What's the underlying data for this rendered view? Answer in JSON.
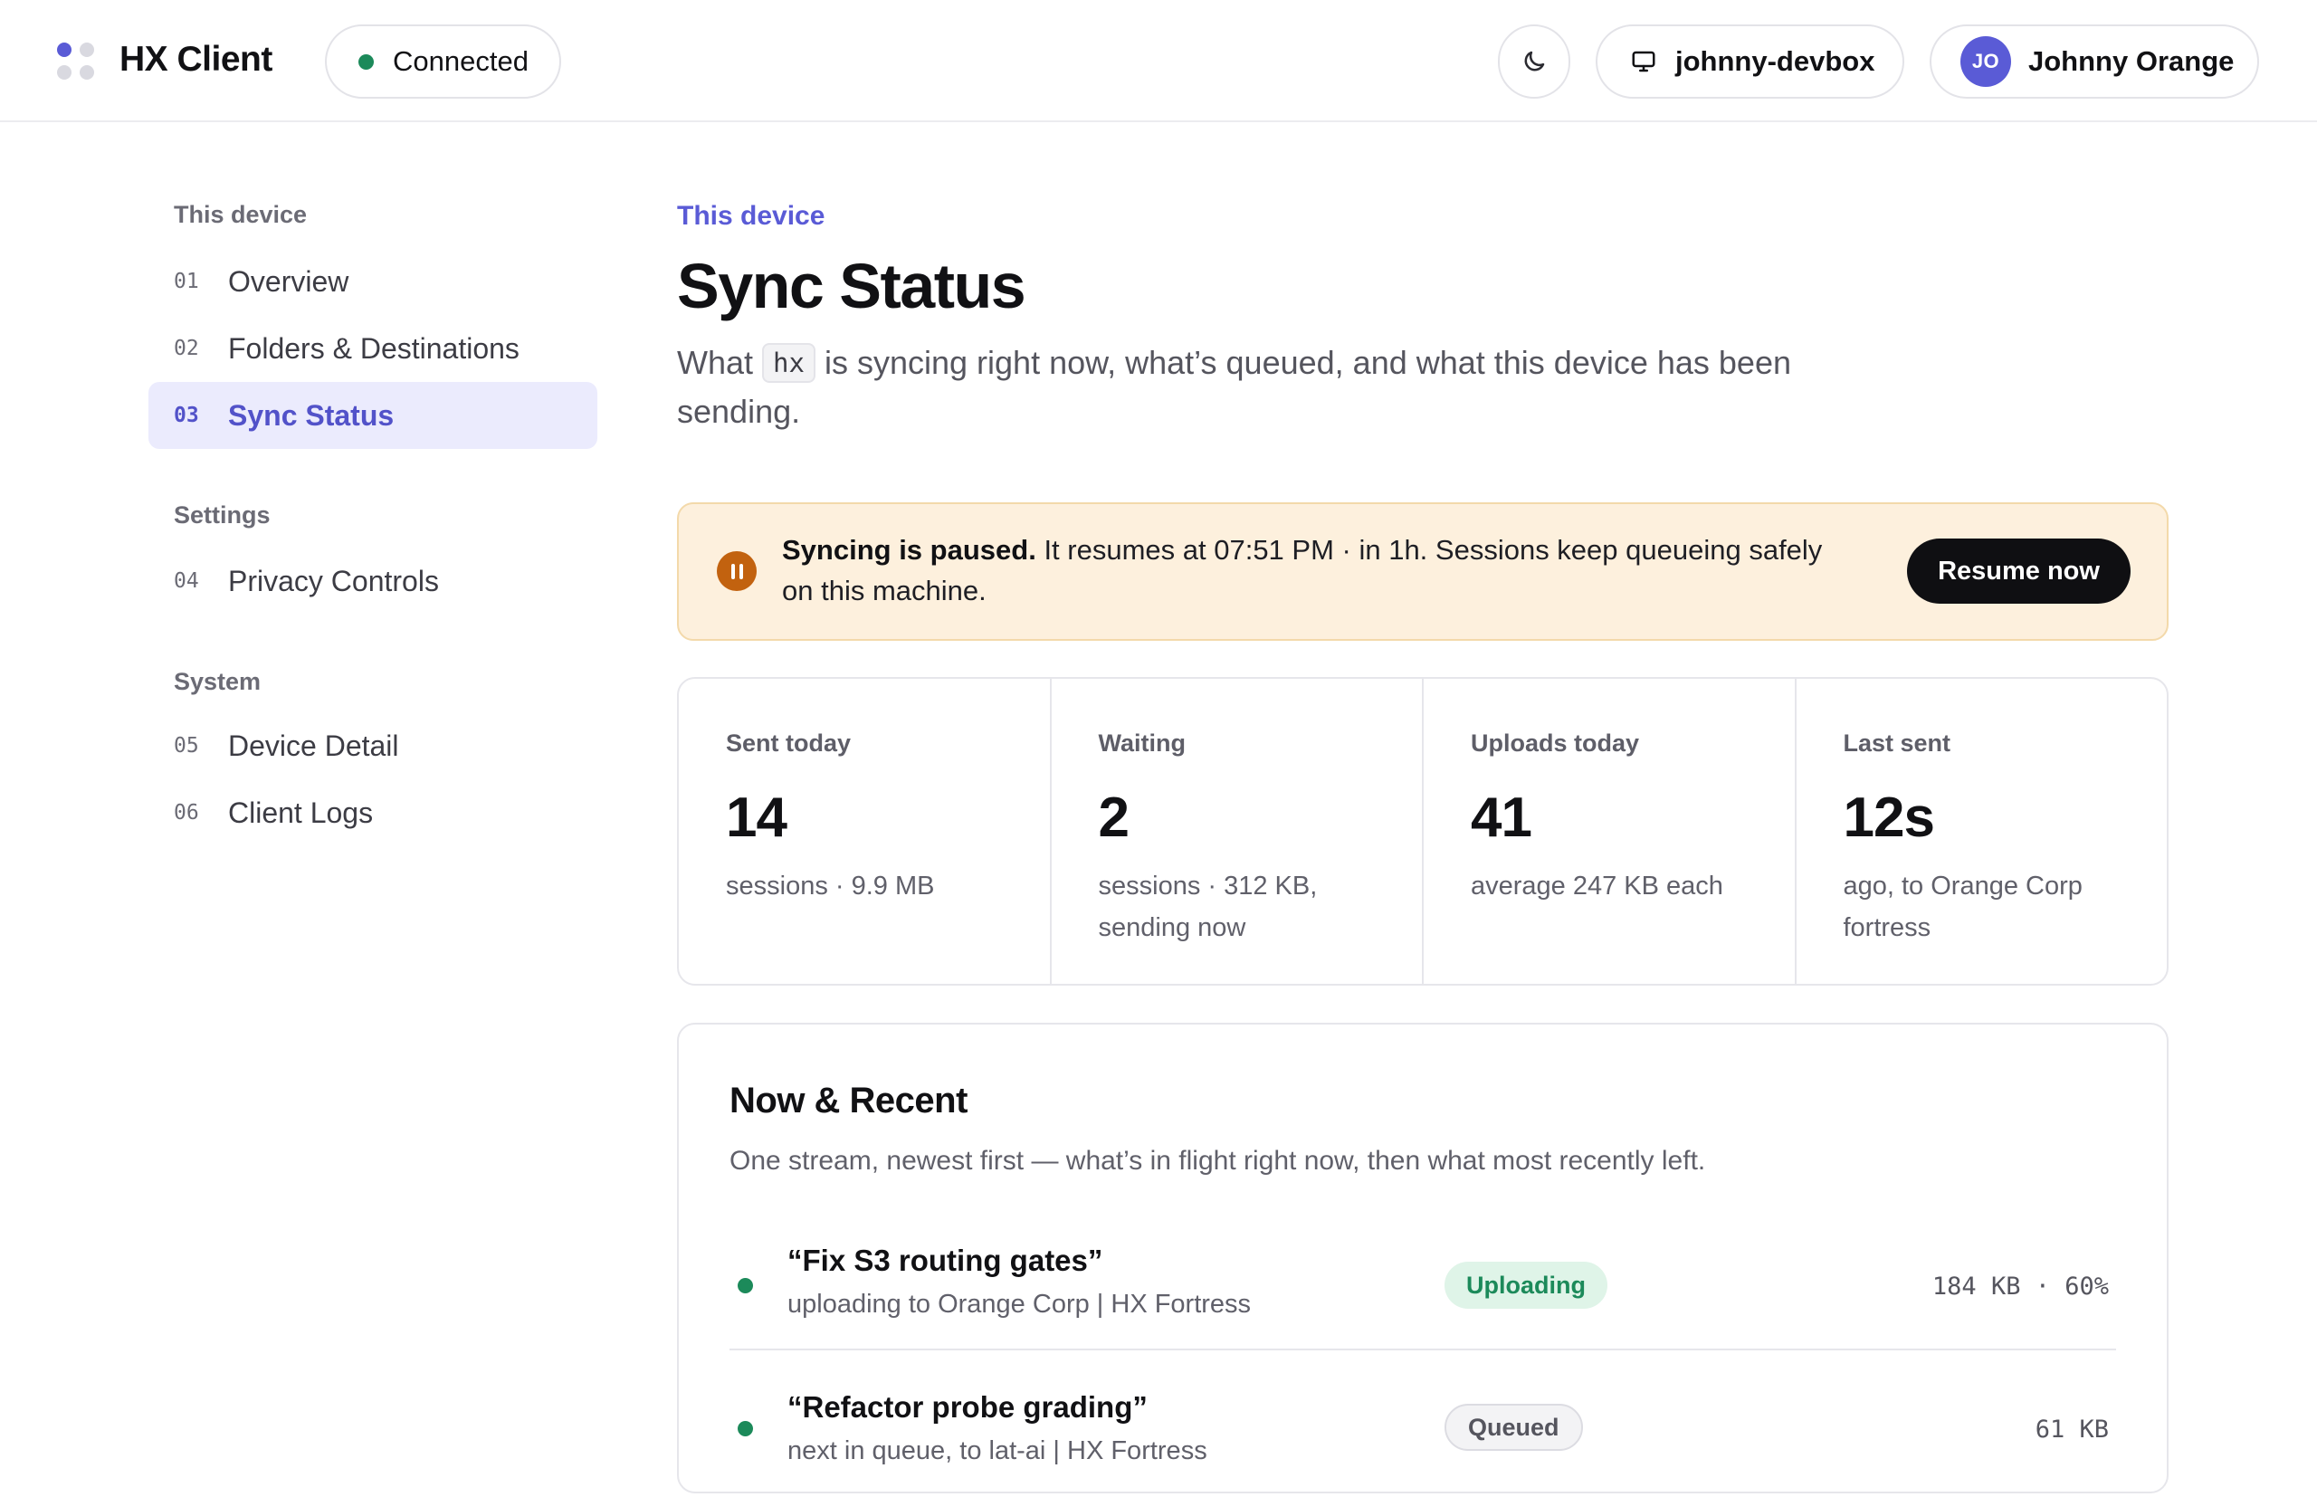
{
  "header": {
    "app_name": "HX Client",
    "connection_status": "Connected",
    "device_name": "johnny-devbox",
    "user_initials": "JO",
    "user_name": "Johnny Orange",
    "icons": {
      "theme": "moon-icon",
      "device": "monitor-icon",
      "logo": "dots-grid-logo"
    },
    "colors": {
      "accent": "#5a5bd6",
      "connected": "#1c8a5a"
    }
  },
  "sidebar": {
    "sections": [
      {
        "title": "This device"
      },
      {
        "title": "Settings"
      },
      {
        "title": "System"
      }
    ],
    "items": [
      {
        "num": "01",
        "label": "Overview"
      },
      {
        "num": "02",
        "label": "Folders & Destinations"
      },
      {
        "num": "03",
        "label": "Sync Status",
        "active": true
      },
      {
        "num": "04",
        "label": "Privacy Controls"
      },
      {
        "num": "05",
        "label": "Device Detail"
      },
      {
        "num": "06",
        "label": "Client Logs"
      }
    ]
  },
  "main": {
    "eyebrow": "This device",
    "title": "Sync Status",
    "subtitle_pre": "What",
    "subtitle_code": "hx",
    "subtitle_post": "is syncing right now, what’s queued, and what this device has been sending.",
    "banner": {
      "bold": "Syncing is paused.",
      "text": "It resumes at 07:51 PM · in 1h. Sessions keep queueing safely on this machine.",
      "button": "Resume now",
      "color": "#fdf0dd"
    },
    "stats": [
      {
        "label": "Sent today",
        "value": "14",
        "note": "sessions · 9.9 MB"
      },
      {
        "label": "Waiting",
        "value": "2",
        "note": "sessions · 312 KB, sending now"
      },
      {
        "label": "Uploads today",
        "value": "41",
        "note": "average 247 KB each"
      },
      {
        "label": "Last sent",
        "value": "12s",
        "note": "ago, to Orange Corp fortress"
      }
    ],
    "recent": {
      "title": "Now & Recent",
      "subtitle": "One stream, newest first — what’s in flight right now, then what most recently left.",
      "rows": [
        {
          "title": "“Fix S3 routing gates”",
          "sub": "uploading to Orange Corp | HX Fortress",
          "badge": "Uploading",
          "meta": "184 KB · 60%"
        },
        {
          "title": "“Refactor probe grading”",
          "sub": "next in queue, to lat-ai | HX Fortress",
          "badge": "Queued",
          "meta": "61 KB"
        }
      ]
    }
  }
}
